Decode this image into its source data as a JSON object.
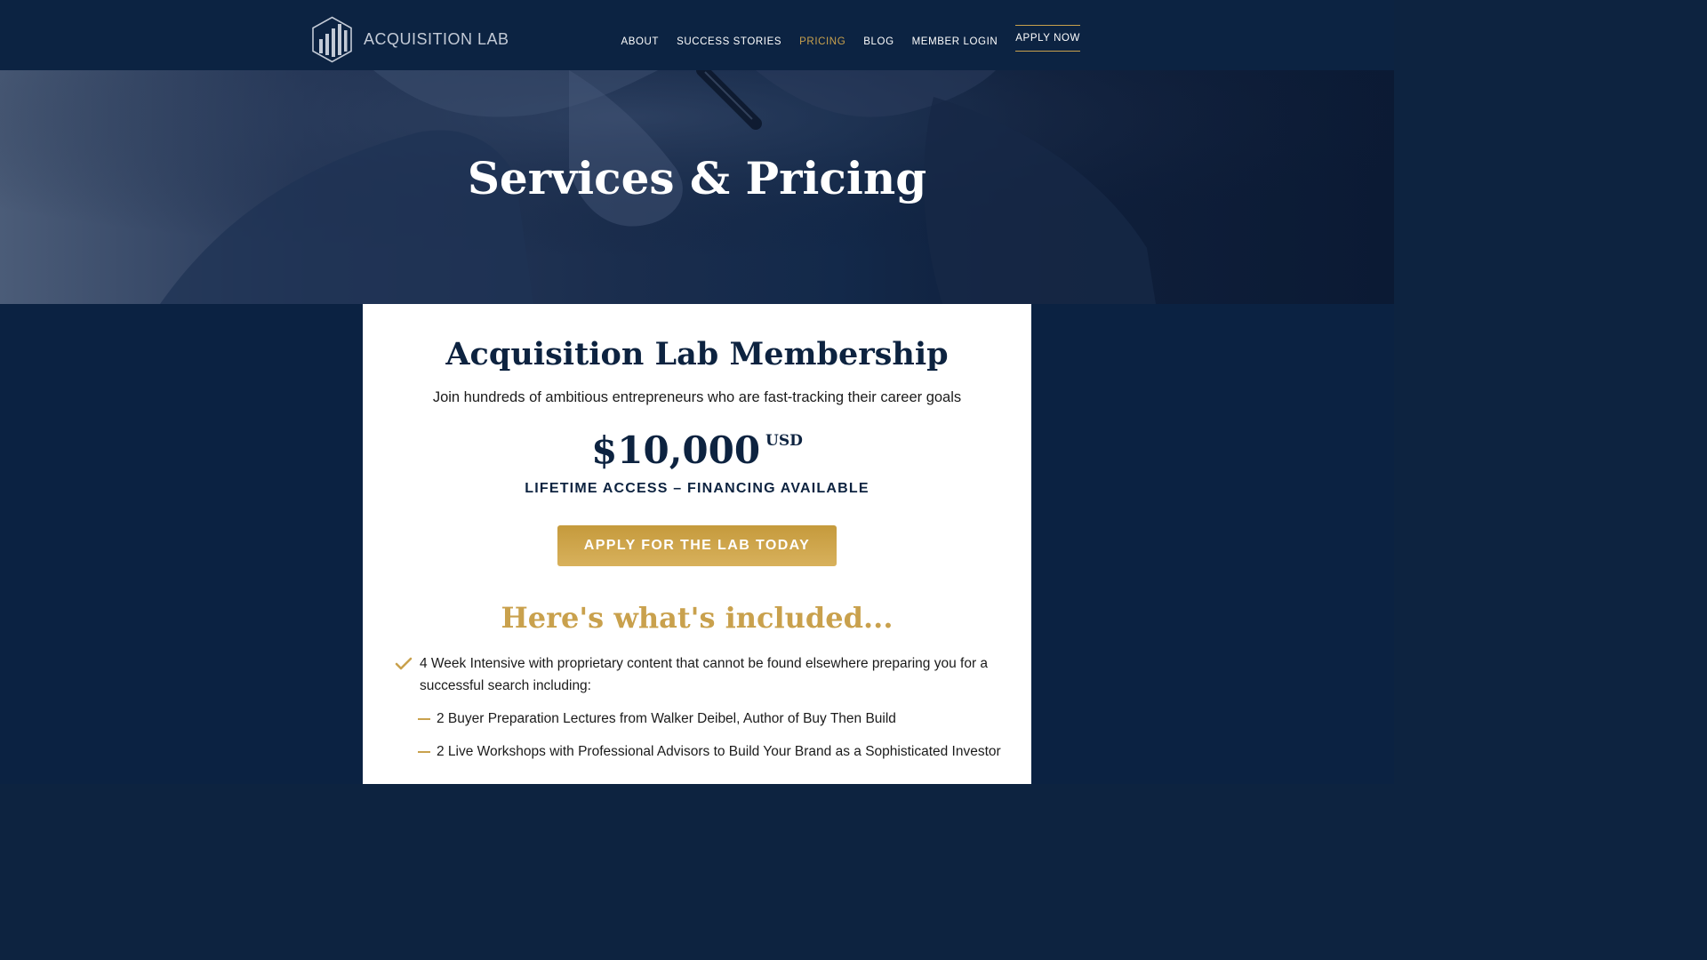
{
  "brand": {
    "name": "ACQUISITION LAB",
    "logo_icon": "hexagon-bars-icon"
  },
  "nav": {
    "items": [
      {
        "label": "ABOUT",
        "active": false
      },
      {
        "label": "SUCCESS STORIES",
        "active": false
      },
      {
        "label": "PRICING",
        "active": true
      },
      {
        "label": "BLOG",
        "active": false
      },
      {
        "label": "MEMBER LOGIN",
        "active": false
      }
    ],
    "apply_label": "APPLY NOW"
  },
  "hero": {
    "title": "Services & Pricing"
  },
  "membership": {
    "title": "Acquisition Lab Membership",
    "subtitle": "Join hundreds of ambitious entrepreneurs who are fast-tracking their career goals",
    "price": "$10,000",
    "currency": "USD",
    "price_note": "LIFETIME ACCESS – FINANCING AVAILABLE",
    "cta_label": "APPLY FOR THE LAB TODAY"
  },
  "included": {
    "title": "Here's what's included...",
    "features": [
      {
        "icon": "check-icon",
        "text": "4 Week Intensive with proprietary content that cannot be found elsewhere preparing you for a successful search including:",
        "sub_items": [
          {
            "icon": "dash-icon",
            "text": "2 Buyer Preparation Lectures from Walker Deibel, Author of Buy Then Build"
          },
          {
            "icon": "dash-icon",
            "text": "2 Live Workshops with Professional Advisors to Build Your Brand as a Sophisticated Investor"
          }
        ]
      }
    ]
  },
  "colors": {
    "navy": "#0d2340",
    "gold": "#c9a14d",
    "white": "#ffffff"
  }
}
